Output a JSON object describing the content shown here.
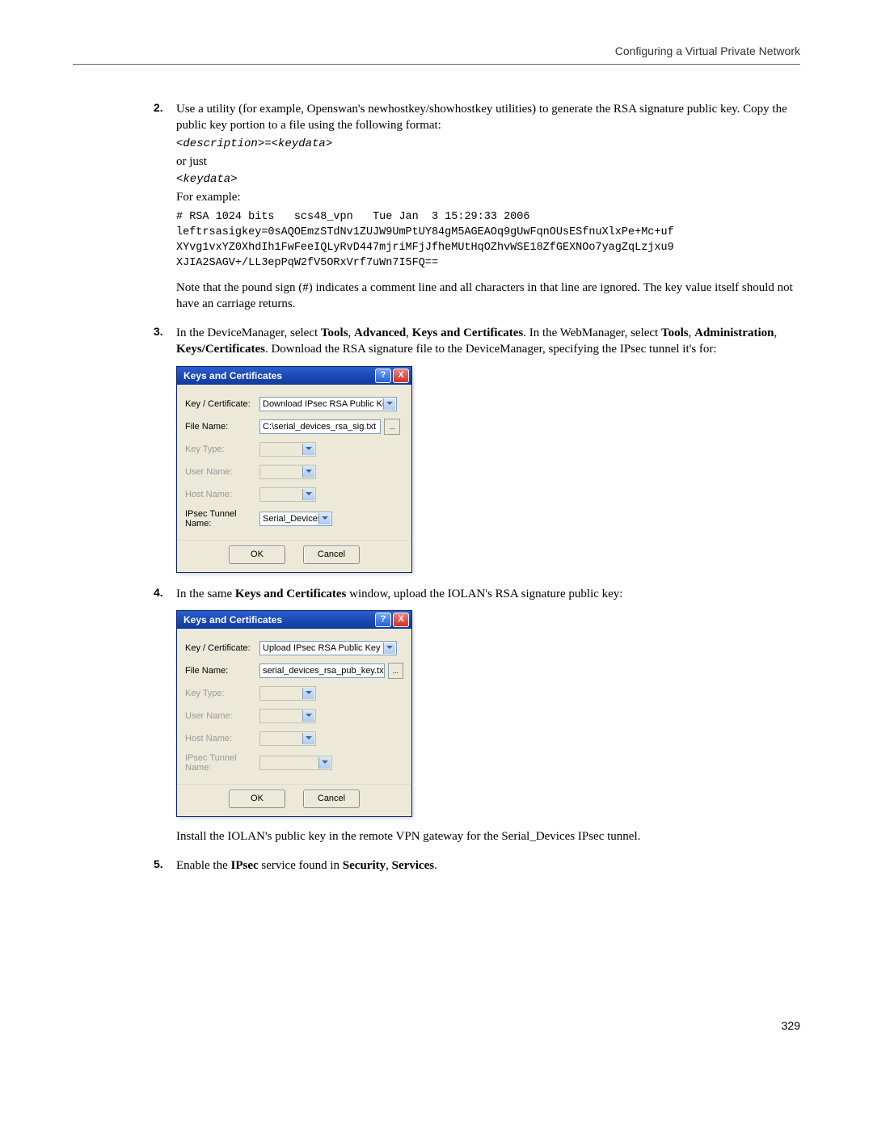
{
  "header": {
    "title": "Configuring a Virtual Private Network"
  },
  "page_number": "329",
  "steps": {
    "s2": {
      "num": "2.",
      "text": "Use a utility (for example, Openswan's newhostkey/showhostkey utilities) to generate the RSA signature public key. Copy the public key portion to a file using the following format:",
      "code1": "<description>=<keydata>",
      "or_just": "or just",
      "code2": "<keydata>",
      "for_example": "For example:",
      "code_block": "# RSA 1024 bits   scs48_vpn   Tue Jan  3 15:29:33 2006\nleftrsasigkey=0sAQOEmzSTdNv1ZUJW9UmPtUY84gM5AGEAOq9gUwFqnOUsESfnuXlxPe+Mc+uf\nXYvg1vxYZ0XhdIh1FwFeeIQLyRvD447mjriMFjJfheMUtHqOZhvWSE18ZfGEXNOo7yagZqLzjxu9\nXJIA2SAGV+/LL3epPqW2fV5ORxVrf7uWn7I5FQ==",
      "note": "Note that the pound sign (#) indicates a comment line and all characters in that line are ignored. The key value itself should not have an carriage returns."
    },
    "s3": {
      "num": "3.",
      "pre": "In the DeviceManager, select ",
      "b1": "Tools",
      "c1": ", ",
      "b2": "Advanced",
      "c2": ", ",
      "b3": "Keys and Certificates",
      "mid": ". In the WebManager, select ",
      "b4": "Tools",
      "c3": ", ",
      "b5": "Administration",
      "c4": ", ",
      "b6": "Keys/Certificates",
      "post": ". Download the RSA signature file to the DeviceManager, specifying the IPsec tunnel it's for:"
    },
    "s4": {
      "num": "4.",
      "pre": "In the same ",
      "b1": "Keys and Certificates",
      "post": " window, upload the IOLAN's RSA signature public key:",
      "after": "Install the IOLAN's public key in the remote VPN gateway for the Serial_Devices IPsec tunnel."
    },
    "s5": {
      "num": "5.",
      "pre": "Enable the ",
      "b1": "IPsec",
      "mid": " service found in ",
      "b2": "Security",
      "c1": ", ",
      "b3": "Services",
      "post": "."
    }
  },
  "dialog_common": {
    "title": "Keys and Certificates",
    "labels": {
      "key_cert": "Key / Certificate:",
      "file_name": "File Name:",
      "key_type": "Key Type:",
      "user_name": "User Name:",
      "host_name": "Host Name:",
      "tunnel": "IPsec Tunnel Name:"
    },
    "ok": "OK",
    "cancel": "Cancel",
    "browse": "..."
  },
  "dialog1": {
    "key_cert_value": "Download IPsec RSA Public Key",
    "file_name_value": "C:\\serial_devices_rsa_sig.txt",
    "tunnel_value": "Serial_Devices",
    "tunnel_enabled": true
  },
  "dialog2": {
    "key_cert_value": "Upload IPsec RSA Public Key",
    "file_name_value": "serial_devices_rsa_pub_key.txt",
    "tunnel_value": "",
    "tunnel_enabled": false
  }
}
